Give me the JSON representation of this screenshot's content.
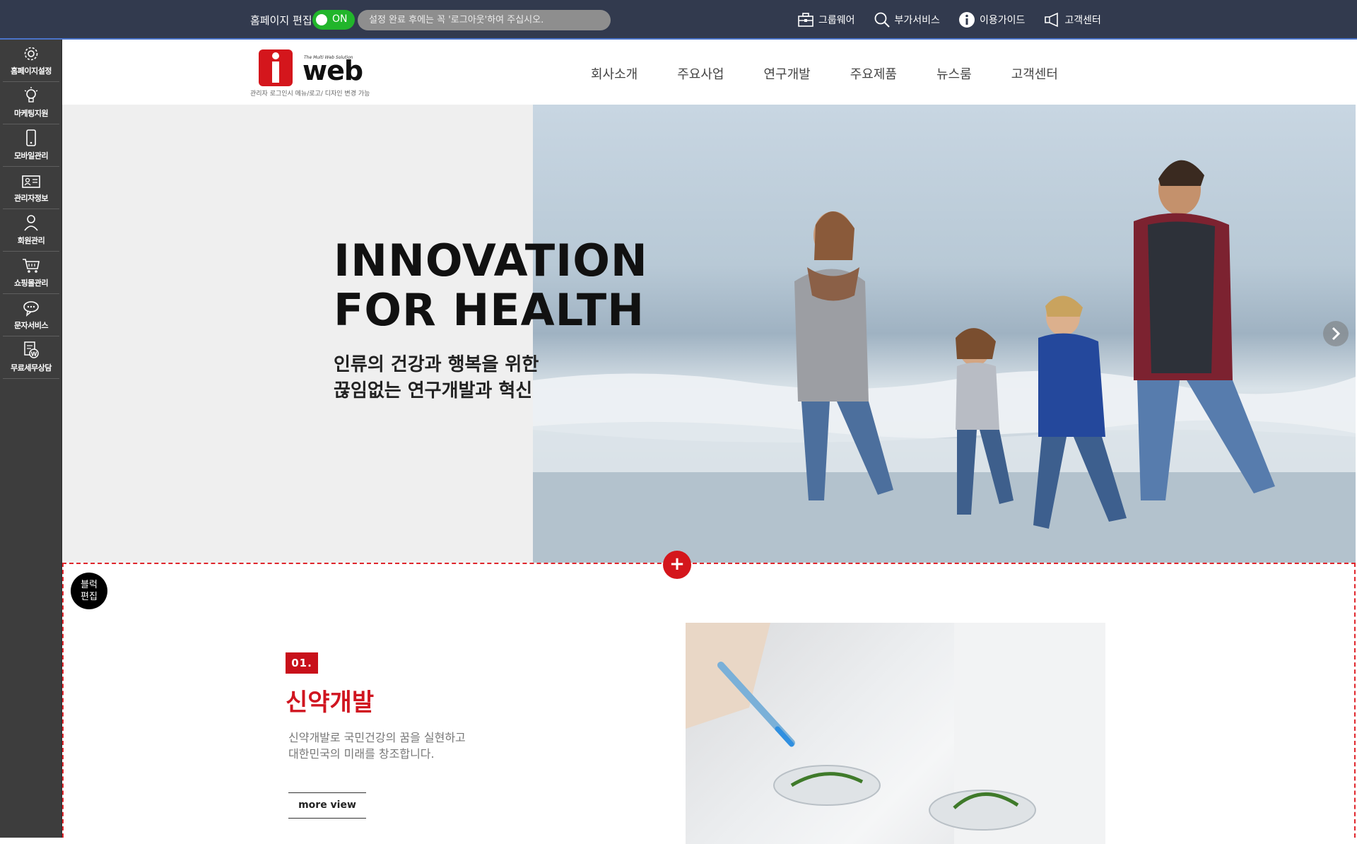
{
  "topbar": {
    "edit_label": "홈페이지 편집",
    "toggle_label": "ON",
    "notice": "설정 완료 후에는 꼭 '로그아웃'하여 주십시오.",
    "links": [
      {
        "label": "그룹웨어",
        "icon": "briefcase-icon"
      },
      {
        "label": "부가서비스",
        "icon": "search-icon"
      },
      {
        "label": "이용가이드",
        "icon": "info-icon"
      },
      {
        "label": "고객센터",
        "icon": "megaphone-icon"
      }
    ]
  },
  "sidebar": {
    "items": [
      {
        "label": "홈페이지설정",
        "icon": "gear-icon"
      },
      {
        "label": "마케팅지원",
        "icon": "lightbulb-icon"
      },
      {
        "label": "모바일관리",
        "icon": "mobile-icon"
      },
      {
        "label": "관리자정보",
        "icon": "id-card-icon"
      },
      {
        "label": "회원관리",
        "icon": "user-icon"
      },
      {
        "label": "쇼핑몰관리",
        "icon": "cart-icon"
      },
      {
        "label": "문자서비스",
        "icon": "chat-icon"
      },
      {
        "label": "무료세무상담",
        "icon": "tax-document-icon"
      }
    ]
  },
  "header": {
    "logo_text": "web",
    "logo_tagline": "The Multi Web Solution",
    "logo_sub": "관리자 로그인시 메뉴/로고/ 디자인 변경 가능",
    "nav": [
      "회사소개",
      "주요사업",
      "연구개발",
      "주요제품",
      "뉴스룸",
      "고객센터"
    ]
  },
  "hero": {
    "title_line1": "INNOVATION",
    "title_line2": "FOR HEALTH",
    "sub_line1": "인류의 건강과 행복을 위한",
    "sub_line2": "끊임없는 연구개발과 혁신"
  },
  "block": {
    "add_label": "+",
    "edit_line1": "블럭",
    "edit_line2": "편집",
    "number": "01.",
    "title": "신약개발",
    "desc_line1": "신약개발로 국민건강의 꿈을 실현하고",
    "desc_line2": "대한민국의 미래를 창조합니다.",
    "more_label": "more view"
  },
  "colors": {
    "topbar_bg": "#323a4e",
    "sidebar_bg": "#3d3d3d",
    "accent_red": "#c8101a",
    "toggle_green": "#21b52b"
  }
}
